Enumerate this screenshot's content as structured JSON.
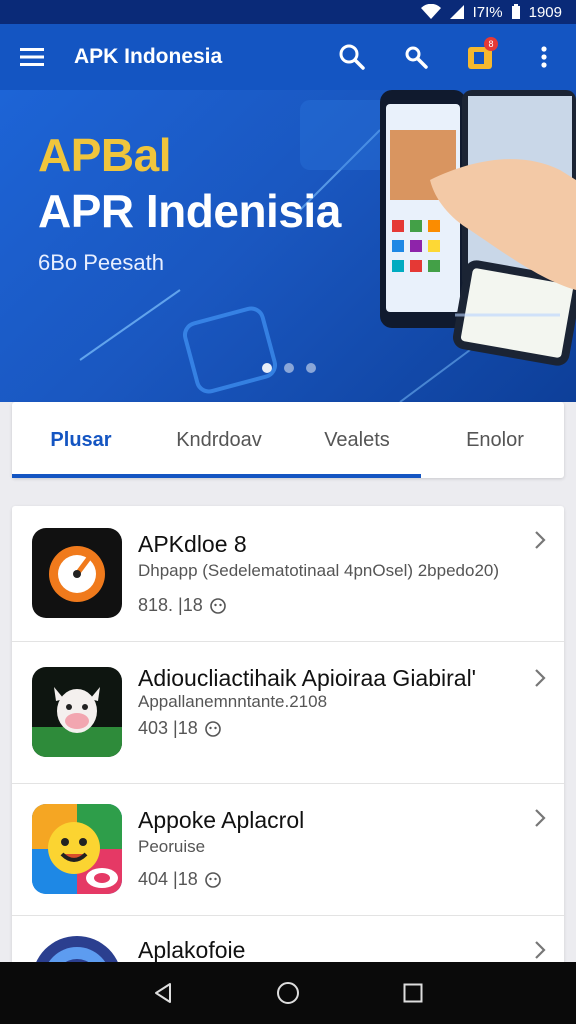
{
  "status": {
    "battery": "I7I%",
    "time": "1909"
  },
  "appbar": {
    "title": "APK Indonesia",
    "notification_count": "8"
  },
  "banner": {
    "line1": "APBal",
    "line2": "APR Indenisia",
    "subtitle": "6Bo Peesath",
    "slides": 3,
    "active_slide": 1
  },
  "tabs": [
    {
      "label": "Plusar",
      "active": true
    },
    {
      "label": "Kndrdoav",
      "active": false
    },
    {
      "label": "Vealets",
      "active": false
    },
    {
      "label": "Enolor",
      "active": false
    }
  ],
  "apps": [
    {
      "name": "APKdloe 8",
      "desc": "Dhpapp (Sedelematotinaal 4pnOsel) 2bpedo20)",
      "meta": "818. |18"
    },
    {
      "name": "Adioucliactihaik Apioiraa Giabiral'",
      "desc": "Appallanemnntante.2108",
      "meta": "403 |18"
    },
    {
      "name": "Appoke Aplacrol",
      "desc": "Peoruise",
      "meta": "404 |18"
    },
    {
      "name": "Aplakofoie",
      "desc": "",
      "meta": ""
    }
  ],
  "colors": {
    "primary": "#1455c2",
    "status_bar": "#0a2a78",
    "accent_yellow": "#f0c53c"
  }
}
